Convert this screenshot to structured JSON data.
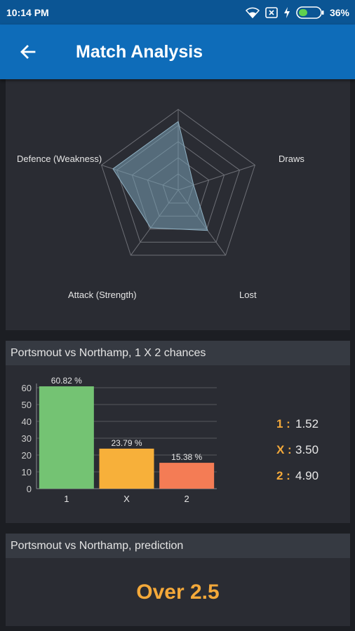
{
  "status": {
    "time": "10:14 PM",
    "battery": "36%"
  },
  "app_bar": {
    "title": "Match Analysis"
  },
  "radar": {
    "labels": {
      "defence": "Defence (Weakness)",
      "draws": "Draws",
      "lost": "Lost",
      "attack": "Attack (Strength)"
    }
  },
  "bar_card": {
    "header": "Portsmout vs Northamp, 1 X 2 chances",
    "odds": [
      {
        "key": "1 :",
        "value": "1.52"
      },
      {
        "key": "X :",
        "value": "3.50"
      },
      {
        "key": "2 :",
        "value": "4.90"
      }
    ]
  },
  "chart_data": {
    "type": "bar",
    "categories": [
      "1",
      "X",
      "2"
    ],
    "values": [
      60.82,
      23.79,
      15.38
    ],
    "data_labels": [
      "60.82 %",
      "23.79 %",
      "15.38 %"
    ],
    "colors": [
      "#74c373",
      "#f7b03a",
      "#f47c55"
    ],
    "ylim": [
      0,
      60
    ],
    "yticks": [
      0,
      10,
      20,
      30,
      40,
      50,
      60
    ],
    "grid": true
  },
  "prediction_card": {
    "header": "Portsmout vs Northamp, prediction",
    "value": "Over 2.5"
  },
  "colors": {
    "primary": "#0e6cb9",
    "status_bar": "#0b5594",
    "accent": "#f4a93a",
    "background": "#1c1e23",
    "card": "#2a2c33"
  }
}
